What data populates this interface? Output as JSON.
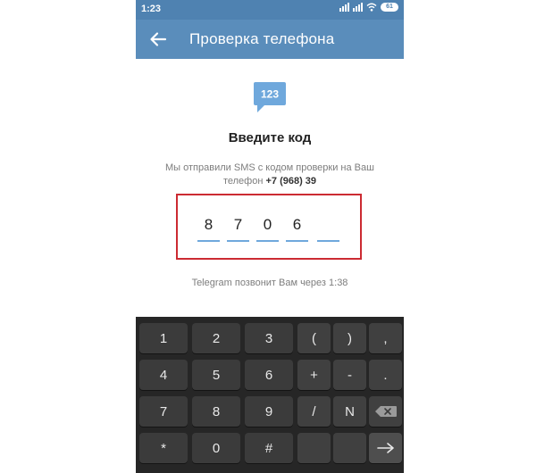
{
  "status_bar": {
    "time": "1:23",
    "battery": "61"
  },
  "app_bar": {
    "title": "Проверка телефона"
  },
  "badge": {
    "text": "123"
  },
  "heading": "Введите код",
  "info": {
    "line1": "Мы отправили SMS с кодом проверки на Ваш",
    "line2_prefix": "телефон",
    "phone": "+7 (968) 39"
  },
  "code": {
    "digits": [
      "8",
      "7",
      "0",
      "6",
      ""
    ]
  },
  "call_notice": "Telegram позвонит Вам через 1:38",
  "keyboard": {
    "rows": [
      [
        "1",
        "2",
        "3",
        "(",
        ")",
        ","
      ],
      [
        "4",
        "5",
        "6",
        "+",
        "-",
        "."
      ],
      [
        "7",
        "8",
        "9",
        "/",
        "N",
        "⌫"
      ],
      [
        "*",
        "0",
        "#",
        "",
        "",
        "→"
      ]
    ]
  },
  "colors": {
    "accent": "#5a8dbb",
    "status_bar": "#4f82b1",
    "highlight": "#cc2b32",
    "code_underline": "#6fa8dc",
    "keyboard_bg": "#262626"
  }
}
